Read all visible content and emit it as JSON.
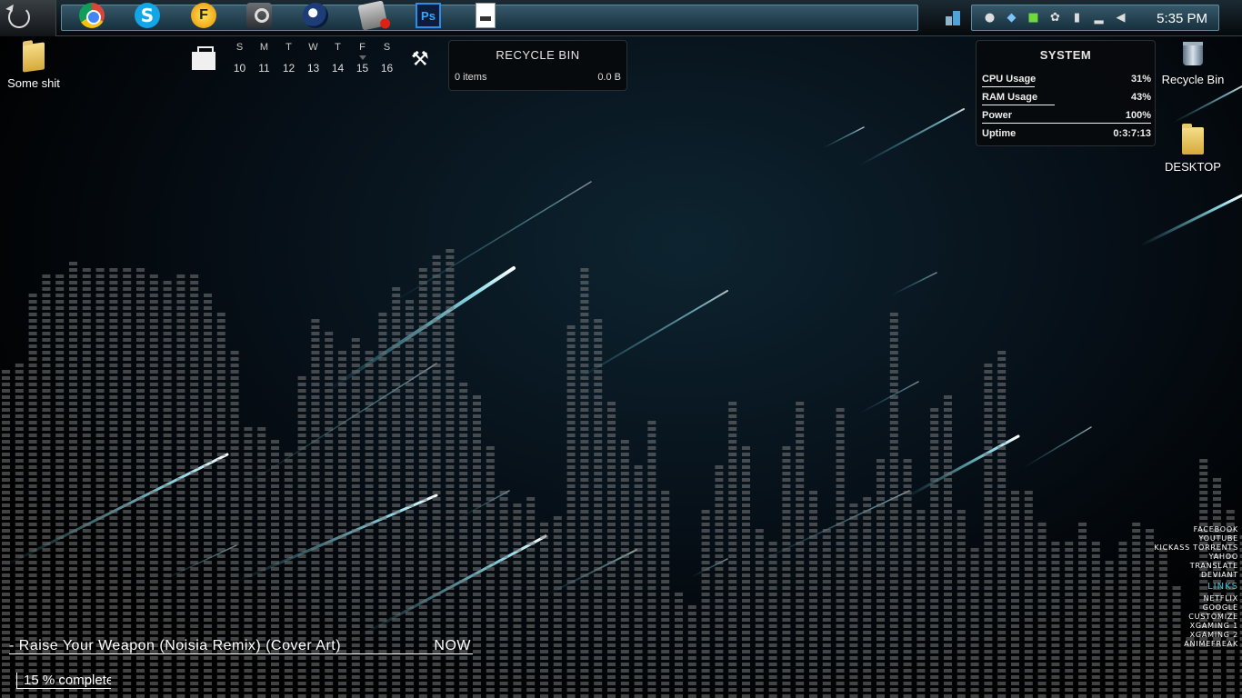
{
  "taskbar": {
    "start_icon": "start-orb-icon",
    "pinned": [
      {
        "name": "chrome",
        "icon": "chrome-icon"
      },
      {
        "name": "skype",
        "icon": "skype-icon",
        "glyph": "S"
      },
      {
        "name": "fl-studio",
        "icon": "fl-studio-icon",
        "glyph": "F"
      },
      {
        "name": "steam",
        "icon": "steam-icon"
      },
      {
        "name": "cinema4d",
        "icon": "cinema4d-icon"
      },
      {
        "name": "tool",
        "icon": "tool-icon"
      },
      {
        "name": "photoshop",
        "icon": "photoshop-icon",
        "glyph": "Ps"
      },
      {
        "name": "document",
        "icon": "document-icon"
      }
    ],
    "tray_icons": [
      "water-drop-icon",
      "dropbox-icon",
      "shield-icon",
      "steam-tray-icon",
      "sd-card-icon",
      "signal-icon",
      "volume-icon"
    ],
    "clock": "5:35 PM"
  },
  "desktop_icons": {
    "some_shit": "Some shit",
    "recycle_bin": "Recycle Bin",
    "desktop": "DESKTOP"
  },
  "calendar": {
    "days": [
      "S",
      "M",
      "T",
      "W",
      "T",
      "F",
      "S"
    ],
    "dates": [
      "10",
      "11",
      "12",
      "13",
      "14",
      "15",
      "16"
    ]
  },
  "recycle_widget": {
    "title": "RECYCLE BIN",
    "items": "0 items",
    "size": "0.0 B"
  },
  "system_widget": {
    "title": "SYSTEM",
    "rows": [
      {
        "label": "CPU Usage",
        "value": "31%",
        "percent": 31
      },
      {
        "label": "RAM Usage",
        "value": "43%",
        "percent": 43
      },
      {
        "label": "Power",
        "value": "100%",
        "percent": 100
      },
      {
        "label": "Uptime",
        "value": "0:3:7:13"
      }
    ]
  },
  "links": {
    "top": [
      "FACEBOOK",
      "YOUTUBE",
      "KICKASS TORRENTS",
      "YAHOO",
      "TRANSLATE",
      "DEVIANT"
    ],
    "heading": "LINKS",
    "bottom": [
      "NETFLIX",
      "GOOGLE",
      "CUSTOMIZE",
      "XGAMING 1",
      "XGAMING 2",
      "ANIMEFREAK"
    ]
  },
  "now_playing": {
    "track": "- Raise Your Weapon (Noisia Remix) (Cover Art)",
    "label": "NOW"
  },
  "download": {
    "text": "15 % complete",
    "percent": 15
  },
  "colors": {
    "accent": "#3ec8d8",
    "visualizer_bar": "#7a7a7a"
  }
}
